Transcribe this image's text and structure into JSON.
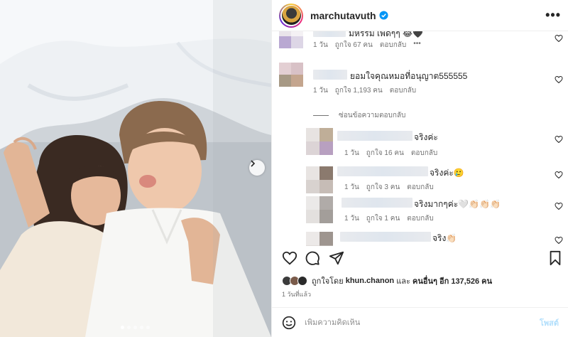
{
  "header": {
    "username": "marchutavuth",
    "more_icon": "more-horizontal-icon"
  },
  "comments": [
    {
      "text": "มหรรม เพิ่ดๆๆ 😂🖤",
      "time": "1 วัน",
      "likes": "ถูกใจ 67 คน",
      "reply": "ตอบกลับ",
      "more": "•••"
    },
    {
      "text": "ยอมใจคุณหมอที่อนุญาต555555",
      "time": "1 วัน",
      "likes": "ถูกใจ 1,193 คน",
      "reply": "ตอบกลับ"
    }
  ],
  "hide_replies": "ซ่อนข้อความตอบกลับ",
  "replies": [
    {
      "text": "จริงค่ะ",
      "time": "1 วัน",
      "likes": "ถูกใจ 16 คน",
      "reply": "ตอบกลับ"
    },
    {
      "text": "จริงค่ะ🥲",
      "time": "1 วัน",
      "likes": "ถูกใจ 3 คน",
      "reply": "ตอบกลับ"
    },
    {
      "text": "จริงมากๆค่ะ🤍👏🏻👏🏻👏🏻",
      "time": "1 วัน",
      "likes": "ถูกใจ 1 คน",
      "reply": "ตอบกลับ"
    },
    {
      "text": "จริง👏🏻"
    }
  ],
  "likes": {
    "prefix": "ถูกใจโดย",
    "user": "khun.chanon",
    "middle": "และ",
    "others": "คนอื่นๆ อีก 137,526 คน"
  },
  "posted": "1 วันที่แล้ว",
  "comment_box": {
    "placeholder": "เพิ่มความคิดเห็น",
    "post_label": "โพสต์"
  },
  "carousel": {
    "dots": 5,
    "active_index": 0
  },
  "colors": {
    "verified": "#0095f6",
    "post_disabled": "#b2dffc",
    "meta": "#737373"
  }
}
